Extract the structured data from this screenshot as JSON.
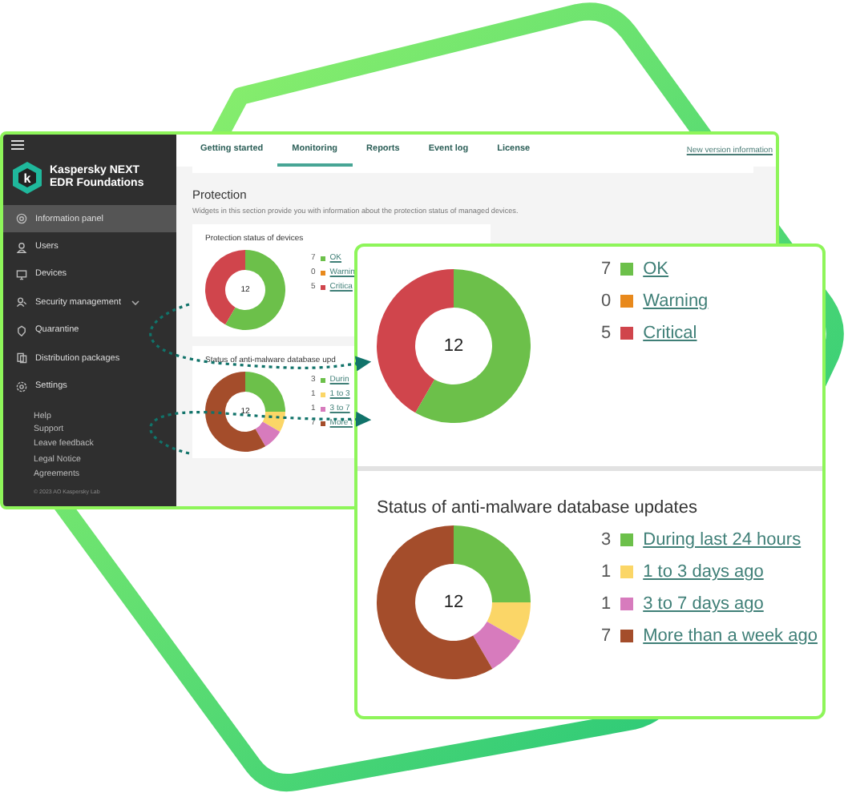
{
  "sidebar": {
    "logo_mark": "k",
    "brand": "Kaspersky NEXT EDR Foundations",
    "items": [
      {
        "label": "Information panel",
        "selected": true,
        "expandable": false
      },
      {
        "label": "Users",
        "selected": false,
        "expandable": false
      },
      {
        "label": "Devices",
        "selected": false,
        "expandable": false
      },
      {
        "label": "Security management",
        "selected": false,
        "expandable": true
      },
      {
        "label": "Quarantine",
        "selected": false,
        "expandable": false
      },
      {
        "label": "Distribution packages",
        "selected": false,
        "expandable": false
      },
      {
        "label": "Settings",
        "selected": false,
        "expandable": false
      }
    ],
    "links": [
      "Help",
      "Support",
      "Leave feedback",
      "Legal Notice",
      "Agreements"
    ],
    "copyright": "© 2023 AO Kaspersky Lab"
  },
  "tabs": [
    {
      "label": "Getting started",
      "selected": false
    },
    {
      "label": "Monitoring",
      "selected": true
    },
    {
      "label": "Reports",
      "selected": false
    },
    {
      "label": "Event log",
      "selected": false
    },
    {
      "label": "License",
      "selected": false
    }
  ],
  "new_version_link": "New version information",
  "section": {
    "title": "Protection",
    "description": "Widgets in this section provide you with information about the protection status of managed devices."
  },
  "widgets": [
    {
      "title": "Protection status of devices",
      "total": "12",
      "legend": [
        {
          "count": "7",
          "label": "OK",
          "color": "#6cc04a"
        },
        {
          "count": "0",
          "label": "Warnin",
          "color": "#e8891c"
        },
        {
          "count": "5",
          "label": "Critica",
          "color": "#d0454c"
        }
      ],
      "chart_data": {
        "type": "donut",
        "values": [
          58.3,
          0,
          41.7
        ]
      }
    },
    {
      "title": "Status of anti-malware database upd",
      "total": "12",
      "legend": [
        {
          "count": "3",
          "label": "Durin",
          "color": "#6cc04a"
        },
        {
          "count": "1",
          "label": "1 to 3",
          "color": "#fbd667"
        },
        {
          "count": "1",
          "label": "3 to 7",
          "color": "#d77bbd"
        },
        {
          "count": "7",
          "label": "More t",
          "color": "#a44d2b"
        }
      ],
      "chart_data": {
        "type": "donut",
        "values": [
          25,
          8.3,
          8.3,
          58.4
        ]
      }
    }
  ],
  "callout": {
    "widgets": [
      {
        "total": "12",
        "legend": [
          {
            "count": "7",
            "label": "OK",
            "color": "#6cc04a"
          },
          {
            "count": "0",
            "label": "Warning",
            "color": "#e8891c"
          },
          {
            "count": "5",
            "label": "Critical",
            "color": "#d0454c"
          }
        ],
        "chart_data": {
          "type": "donut",
          "values": [
            58.3,
            0,
            41.7
          ]
        }
      },
      {
        "title": "Status of anti-malware database updates",
        "total": "12",
        "legend": [
          {
            "count": "3",
            "label": "During last 24 hours",
            "color": "#6cc04a"
          },
          {
            "count": "1",
            "label": "1 to 3 days ago",
            "color": "#fbd667"
          },
          {
            "count": "1",
            "label": "3 to 7 days ago",
            "color": "#d77bbd"
          },
          {
            "count": "7",
            "label": "More than a week ago",
            "color": "#a44d2b"
          }
        ],
        "chart_data": {
          "type": "donut",
          "values": [
            25,
            8.3,
            8.3,
            58.4
          ]
        }
      }
    ]
  }
}
